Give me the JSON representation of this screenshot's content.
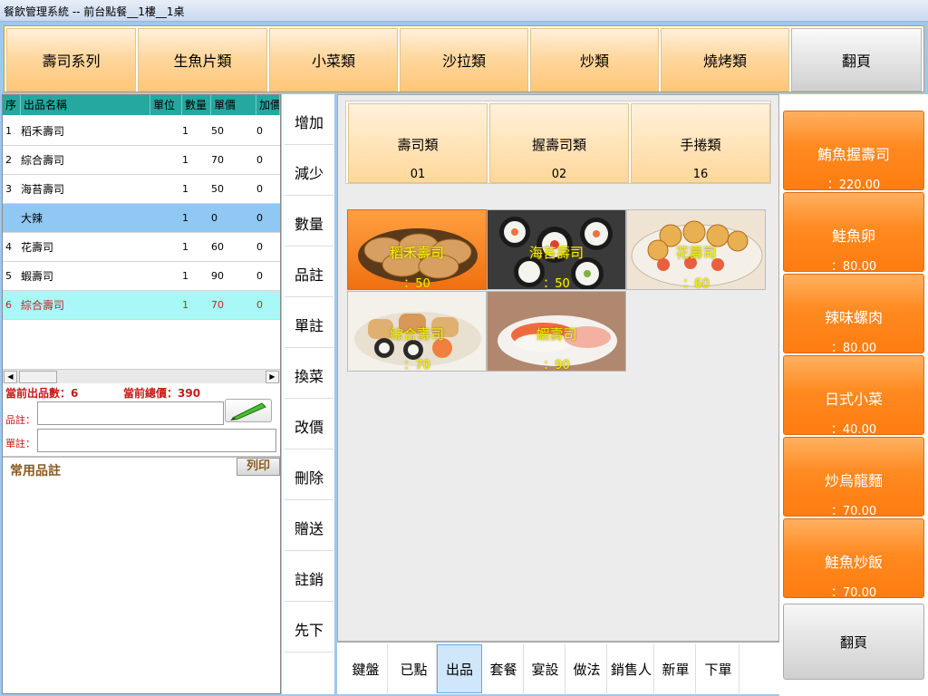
{
  "window": {
    "title": "餐飲管理系統 -- 前台點餐__1樓__1桌"
  },
  "categories": [
    "壽司系列",
    "生魚片類",
    "小菜類",
    "沙拉類",
    "炒類",
    "燒烤類",
    "翻頁"
  ],
  "grid": {
    "headers": [
      "序",
      "出品名稱",
      "單位",
      "數量",
      "單價",
      "加價"
    ],
    "rows": [
      {
        "seq": "1",
        "name": "稻禾壽司",
        "unit": "",
        "qty": "1",
        "price": "50",
        "add": "0"
      },
      {
        "seq": "2",
        "name": "綜合壽司",
        "unit": "",
        "qty": "1",
        "price": "70",
        "add": "0"
      },
      {
        "seq": "3",
        "name": "海苔壽司",
        "unit": "",
        "qty": "1",
        "price": "50",
        "add": "0"
      },
      {
        "seq": "",
        "name": "大辣",
        "unit": "",
        "qty": "1",
        "price": "0",
        "add": "0"
      },
      {
        "seq": "4",
        "name": "花壽司",
        "unit": "",
        "qty": "1",
        "price": "60",
        "add": "0"
      },
      {
        "seq": "5",
        "name": "蝦壽司",
        "unit": "",
        "qty": "1",
        "price": "90",
        "add": "0"
      },
      {
        "seq": "6",
        "name": "綜合壽司",
        "unit": "",
        "qty": "1",
        "price": "70",
        "add": "0"
      }
    ]
  },
  "summary": {
    "count": "當前出品數：6",
    "total": "當前總價：390"
  },
  "fields": {
    "item_note_label": "品註：",
    "order_note_label": "單註："
  },
  "notes": {
    "label": "常用品註",
    "print": "列印"
  },
  "actions": [
    "增加",
    "減少",
    "數量",
    "品註",
    "單註",
    "換菜",
    "改價",
    "刪除",
    "贈送",
    "註銷",
    "先下"
  ],
  "subcategories": [
    {
      "name": "壽司類",
      "code": "01"
    },
    {
      "name": "握壽司類",
      "code": "02"
    },
    {
      "name": "手捲類",
      "code": "16"
    }
  ],
  "items": [
    {
      "name": "稻禾壽司",
      "price": "：50"
    },
    {
      "name": "海苔壽司",
      "price": "：50"
    },
    {
      "name": "花壽司",
      "price": "：60"
    },
    {
      "name": "綜合壽司",
      "price": "：70"
    },
    {
      "name": "蝦壽司",
      "price": "：90"
    }
  ],
  "tabs": [
    "鍵盤",
    "已點",
    "出品",
    "套餐",
    "宴設",
    "做法",
    "銷售人",
    "新單",
    "下單"
  ],
  "specials": [
    {
      "name": "鮪魚握壽司",
      "price": "：220.00"
    },
    {
      "name": "鮭魚卵",
      "price": "：80.00"
    },
    {
      "name": "辣味螺肉",
      "price": "：80.00"
    },
    {
      "name": "日式小菜",
      "price": "：40.00"
    },
    {
      "name": "炒烏龍麵",
      "price": "：70.00"
    },
    {
      "name": "鮭魚炒飯",
      "price": "：70.00"
    }
  ],
  "right_page": "翻頁",
  "colors": {
    "accent_orange": "#ff8a20",
    "grid_header": "#24a8a0",
    "selected_row": "#90c8f4",
    "current_row": "#a8f8f8",
    "warning_red": "#c81818"
  }
}
